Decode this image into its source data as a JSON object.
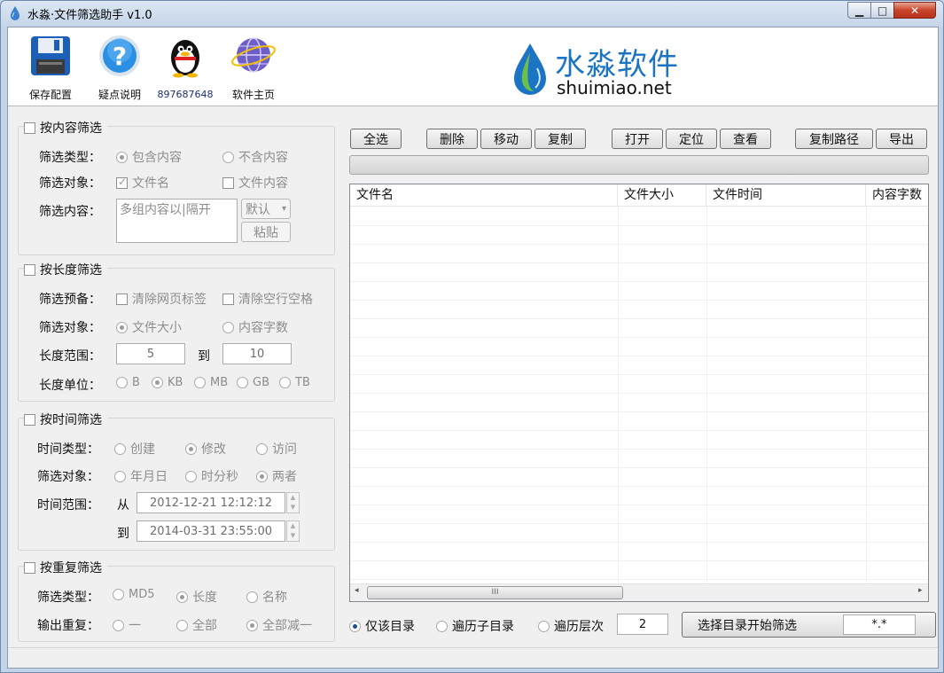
{
  "window": {
    "title": "水淼·文件筛选助手 v1.0",
    "min": "▁",
    "max": "□",
    "close": "✕"
  },
  "toolbar": {
    "save": "保存配置",
    "help": "疑点说明",
    "qq": "897687648",
    "home": "软件主页"
  },
  "logo": {
    "name": "水淼软件",
    "url": "shuimiao.net"
  },
  "content_filter": {
    "title": "按内容筛选",
    "type_label": "筛选类型：",
    "type_opt1": "包含内容",
    "type_opt2": "不含内容",
    "target_label": "筛选对象：",
    "target_opt1": "文件名",
    "target_opt2": "文件内容",
    "content_label": "筛选内容：",
    "content_placeholder": "多组内容以|隔开",
    "mode_value": "默认",
    "mode_arrow": "▾",
    "paste": "粘贴"
  },
  "length_filter": {
    "title": "按长度筛选",
    "pre_label": "筛选预备：",
    "pre_opt1": "清除网页标签",
    "pre_opt2": "清除空行空格",
    "target_label": "筛选对象：",
    "target_opt1": "文件大小",
    "target_opt2": "内容字数",
    "range_label": "长度范围：",
    "range_from": "5",
    "range_to_label": "到",
    "range_to": "10",
    "unit_label": "长度单位：",
    "units": [
      "B",
      "KB",
      "MB",
      "GB",
      "TB"
    ]
  },
  "time_filter": {
    "title": "按时间筛选",
    "type_label": "时间类型：",
    "type_opt1": "创建",
    "type_opt2": "修改",
    "type_opt3": "访问",
    "target_label": "筛选对象：",
    "target_opt1": "年月日",
    "target_opt2": "时分秒",
    "target_opt3": "两者",
    "range_label": "时间范围：",
    "from_label": "从",
    "from_value": "2012-12-21 12:12:12",
    "to_label": "到",
    "to_value": "2014-03-31 23:55:00"
  },
  "dup_filter": {
    "title": "按重复筛选",
    "type_label": "筛选类型：",
    "type_opt1": "MD5",
    "type_opt2": "长度",
    "type_opt3": "名称",
    "out_label": "输出重复：",
    "out_opt1": "一",
    "out_opt2": "全部",
    "out_opt3": "全部减一"
  },
  "actions": {
    "select_all": "全选",
    "delete": "删除",
    "move": "移动",
    "copy": "复制",
    "open": "打开",
    "locate": "定位",
    "view": "查看",
    "copy_path": "复制路径",
    "export": "导出"
  },
  "table": {
    "columns": [
      "文件名",
      "文件大小",
      "文件时间",
      "内容字数"
    ],
    "rows": []
  },
  "scrollbar": {
    "left": "◂",
    "right": "▸",
    "grip": "III"
  },
  "bottom": {
    "opt1": "仅该目录",
    "opt2": "遍历子目录",
    "opt3": "遍历层次",
    "depth": "2",
    "start": "选择目录开始筛选",
    "pattern": "*.*"
  },
  "colors": {
    "brand": "#1c74c4",
    "titlebar": "#c4d4e8",
    "close": "#c7452a"
  }
}
